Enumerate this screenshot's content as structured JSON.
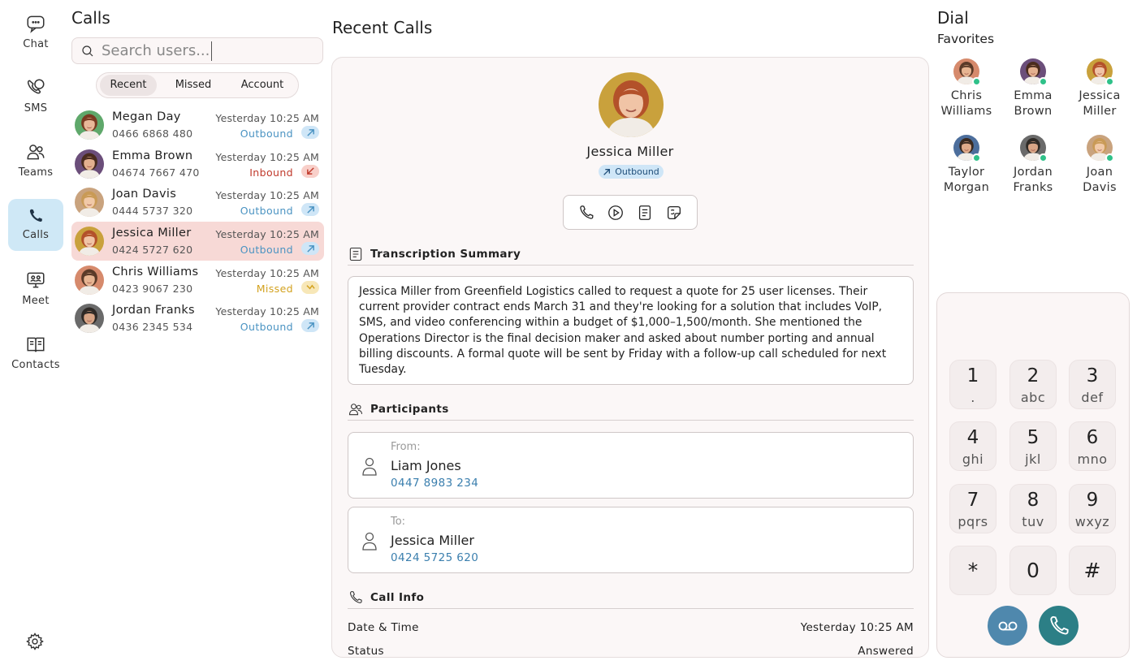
{
  "nav": {
    "items": [
      {
        "label": "Chat",
        "icon": "chat-icon",
        "active": false
      },
      {
        "label": "SMS",
        "icon": "sms-icon",
        "active": false
      },
      {
        "label": "Teams",
        "icon": "teams-icon",
        "active": false
      },
      {
        "label": "Calls",
        "icon": "phone-icon",
        "active": true
      },
      {
        "label": "Meet",
        "icon": "meet-icon",
        "active": false
      },
      {
        "label": "Contacts",
        "icon": "contacts-icon",
        "active": false
      }
    ],
    "settings_icon": "gear-icon"
  },
  "calls": {
    "title": "Calls",
    "search_placeholder": "Search users...",
    "tabs": [
      {
        "label": "Recent",
        "active": true
      },
      {
        "label": "Missed",
        "active": false
      },
      {
        "label": "Account",
        "active": false
      }
    ],
    "items": [
      {
        "name": "Megan Day",
        "number": "0466 6868 480",
        "time": "Yesterday 10:25 AM",
        "direction": "Outbound",
        "dir_color": "#4a93c2",
        "icon_bg": "#cfe6f7",
        "selected": false,
        "avatar": {
          "bg": "#5fa86b",
          "hair": "#7a3b22",
          "skin": "#e9b899"
        }
      },
      {
        "name": "Emma Brown",
        "number": "04674 7667 470",
        "time": "Yesterday 10:25 AM",
        "direction": "Inbound",
        "dir_color": "#c0392b",
        "icon_bg": "#f8cfc9",
        "selected": false,
        "avatar": {
          "bg": "#6b4e7a",
          "hair": "#4a2c1e",
          "skin": "#e3b08f"
        }
      },
      {
        "name": "Joan Davis",
        "number": "0444 5737 320",
        "time": "Yesterday 10:25 AM",
        "direction": "Outbound",
        "dir_color": "#4a93c2",
        "icon_bg": "#cfe6f7",
        "selected": false,
        "avatar": {
          "bg": "#c9a37e",
          "hair": "#c99a56",
          "skin": "#f1c9a8"
        }
      },
      {
        "name": "Jessica Miller",
        "number": "0424 5727 620",
        "time": "Yesterday 10:25 AM",
        "direction": "Outbound",
        "dir_color": "#4a93c2",
        "icon_bg": "#cfe6f7",
        "selected": true,
        "avatar": {
          "bg": "#c9a13c",
          "hair": "#b3512a",
          "skin": "#f0c4a6"
        }
      },
      {
        "name": "Chris Williams",
        "number": "0423 9067 230",
        "time": "Yesterday 10:25 AM",
        "direction": "Missed",
        "dir_color": "#d3a21f",
        "icon_bg": "#f7e7b8",
        "selected": false,
        "avatar": {
          "bg": "#d68a6c",
          "hair": "#5a3a28",
          "skin": "#e7b592"
        }
      },
      {
        "name": "Jordan Franks",
        "number": "0436 2345 534",
        "time": "Yesterday 10:25 AM",
        "direction": "Outbound",
        "dir_color": "#4a93c2",
        "icon_bg": "#cfe6f7",
        "selected": false,
        "avatar": {
          "bg": "#6a6a6a",
          "hair": "#2f2a26",
          "skin": "#d8a586"
        }
      }
    ]
  },
  "detail": {
    "title": "Recent Calls",
    "contact_name": "Jessica Miller",
    "direction_badge": "Outbound",
    "actions": [
      "phone-icon",
      "play-icon",
      "transcript-icon",
      "sticker-icon"
    ],
    "transcription_title": "Transcription Summary",
    "transcription_text": "Jessica Miller from Greenfield Logistics called to request a quote for 25 user licenses. Their current provider contract ends March 31 and they're looking for a solution that includes VoIP, SMS, and video conferencing within a budget of $1,000–1,500/month. She mentioned the Operations Director is the final decision maker and asked about number porting and annual billing discounts. A formal quote will be sent by Friday with a follow-up call scheduled for next Tuesday.",
    "participants_title": "Participants",
    "from": {
      "label": "From:",
      "name": "Liam Jones",
      "number": "0447 8983 234"
    },
    "to": {
      "label": "To:",
      "name": "Jessica Miller",
      "number": "0424 5725 620"
    },
    "call_info_title": "Call Info",
    "info": [
      {
        "label": "Date & Time",
        "value": "Yesterday 10:25 AM"
      },
      {
        "label": "Status",
        "value": "Answered"
      }
    ]
  },
  "dial": {
    "title": "Dial",
    "favorites_title": "Favorites",
    "favorites": [
      {
        "first": "Chris",
        "last": "Williams",
        "avatar": {
          "bg": "#d68a6c",
          "hair": "#5a3a28",
          "skin": "#e7b592"
        }
      },
      {
        "first": "Emma",
        "last": "Brown",
        "avatar": {
          "bg": "#6b4e7a",
          "hair": "#4a2c1e",
          "skin": "#e3b08f"
        }
      },
      {
        "first": "Jessica",
        "last": "Miller",
        "avatar": {
          "bg": "#c9a13c",
          "hair": "#b3512a",
          "skin": "#f0c4a6"
        }
      },
      {
        "first": "Taylor",
        "last": "Morgan",
        "avatar": {
          "bg": "#4c6e9c",
          "hair": "#3a2a20",
          "skin": "#e0ab8a"
        }
      },
      {
        "first": "Jordan",
        "last": "Franks",
        "avatar": {
          "bg": "#6a6a6a",
          "hair": "#2f2a26",
          "skin": "#d8a586"
        }
      },
      {
        "first": "Joan",
        "last": "Davis",
        "avatar": {
          "bg": "#c9a37e",
          "hair": "#c99a56",
          "skin": "#f1c9a8"
        }
      }
    ],
    "keys": [
      {
        "digit": "1",
        "letters": "."
      },
      {
        "digit": "2",
        "letters": "abc"
      },
      {
        "digit": "3",
        "letters": "def"
      },
      {
        "digit": "4",
        "letters": "ghi"
      },
      {
        "digit": "5",
        "letters": "jkl"
      },
      {
        "digit": "6",
        "letters": "mno"
      },
      {
        "digit": "7",
        "letters": "pqrs"
      },
      {
        "digit": "8",
        "letters": "tuv"
      },
      {
        "digit": "9",
        "letters": "wxyz"
      },
      {
        "digit": "*",
        "letters": ""
      },
      {
        "digit": "0",
        "letters": ""
      },
      {
        "digit": "#",
        "letters": ""
      }
    ],
    "voicemail_icon": "voicemail-icon",
    "call_icon": "phone-icon",
    "colors": {
      "voicemail": "#4f88ad",
      "call": "#2c7f86"
    }
  }
}
